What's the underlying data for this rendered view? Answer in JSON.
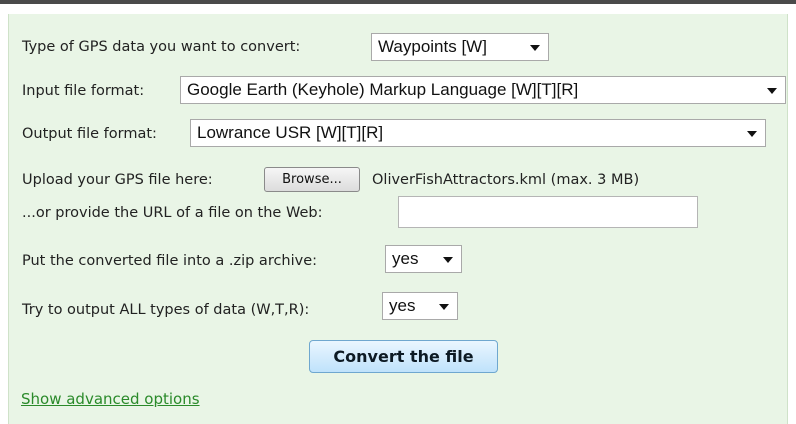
{
  "form": {
    "gps_type": {
      "label": "Type of GPS data you want to convert:",
      "value": "Waypoints [W]"
    },
    "input_format": {
      "label": "Input file format:",
      "value": "Google Earth (Keyhole) Markup Language [W][T][R]"
    },
    "output_format": {
      "label": "Output file format:",
      "value": "Lowrance USR [W][T][R]"
    },
    "upload": {
      "label": "Upload your GPS file here:",
      "browse_label": "Browse...",
      "file_info": "OliverFishAttractors.kml (max. 3 MB)"
    },
    "url": {
      "label": "...or provide the URL of a file on the Web:",
      "value": ""
    },
    "zip": {
      "label": "Put the converted file into a .zip archive:",
      "value": "yes"
    },
    "all_types": {
      "label": "Try to output ALL types of data (W,T,R):",
      "value": "yes"
    },
    "convert_label": "Convert the file",
    "advanced_link": "Show advanced options"
  }
}
